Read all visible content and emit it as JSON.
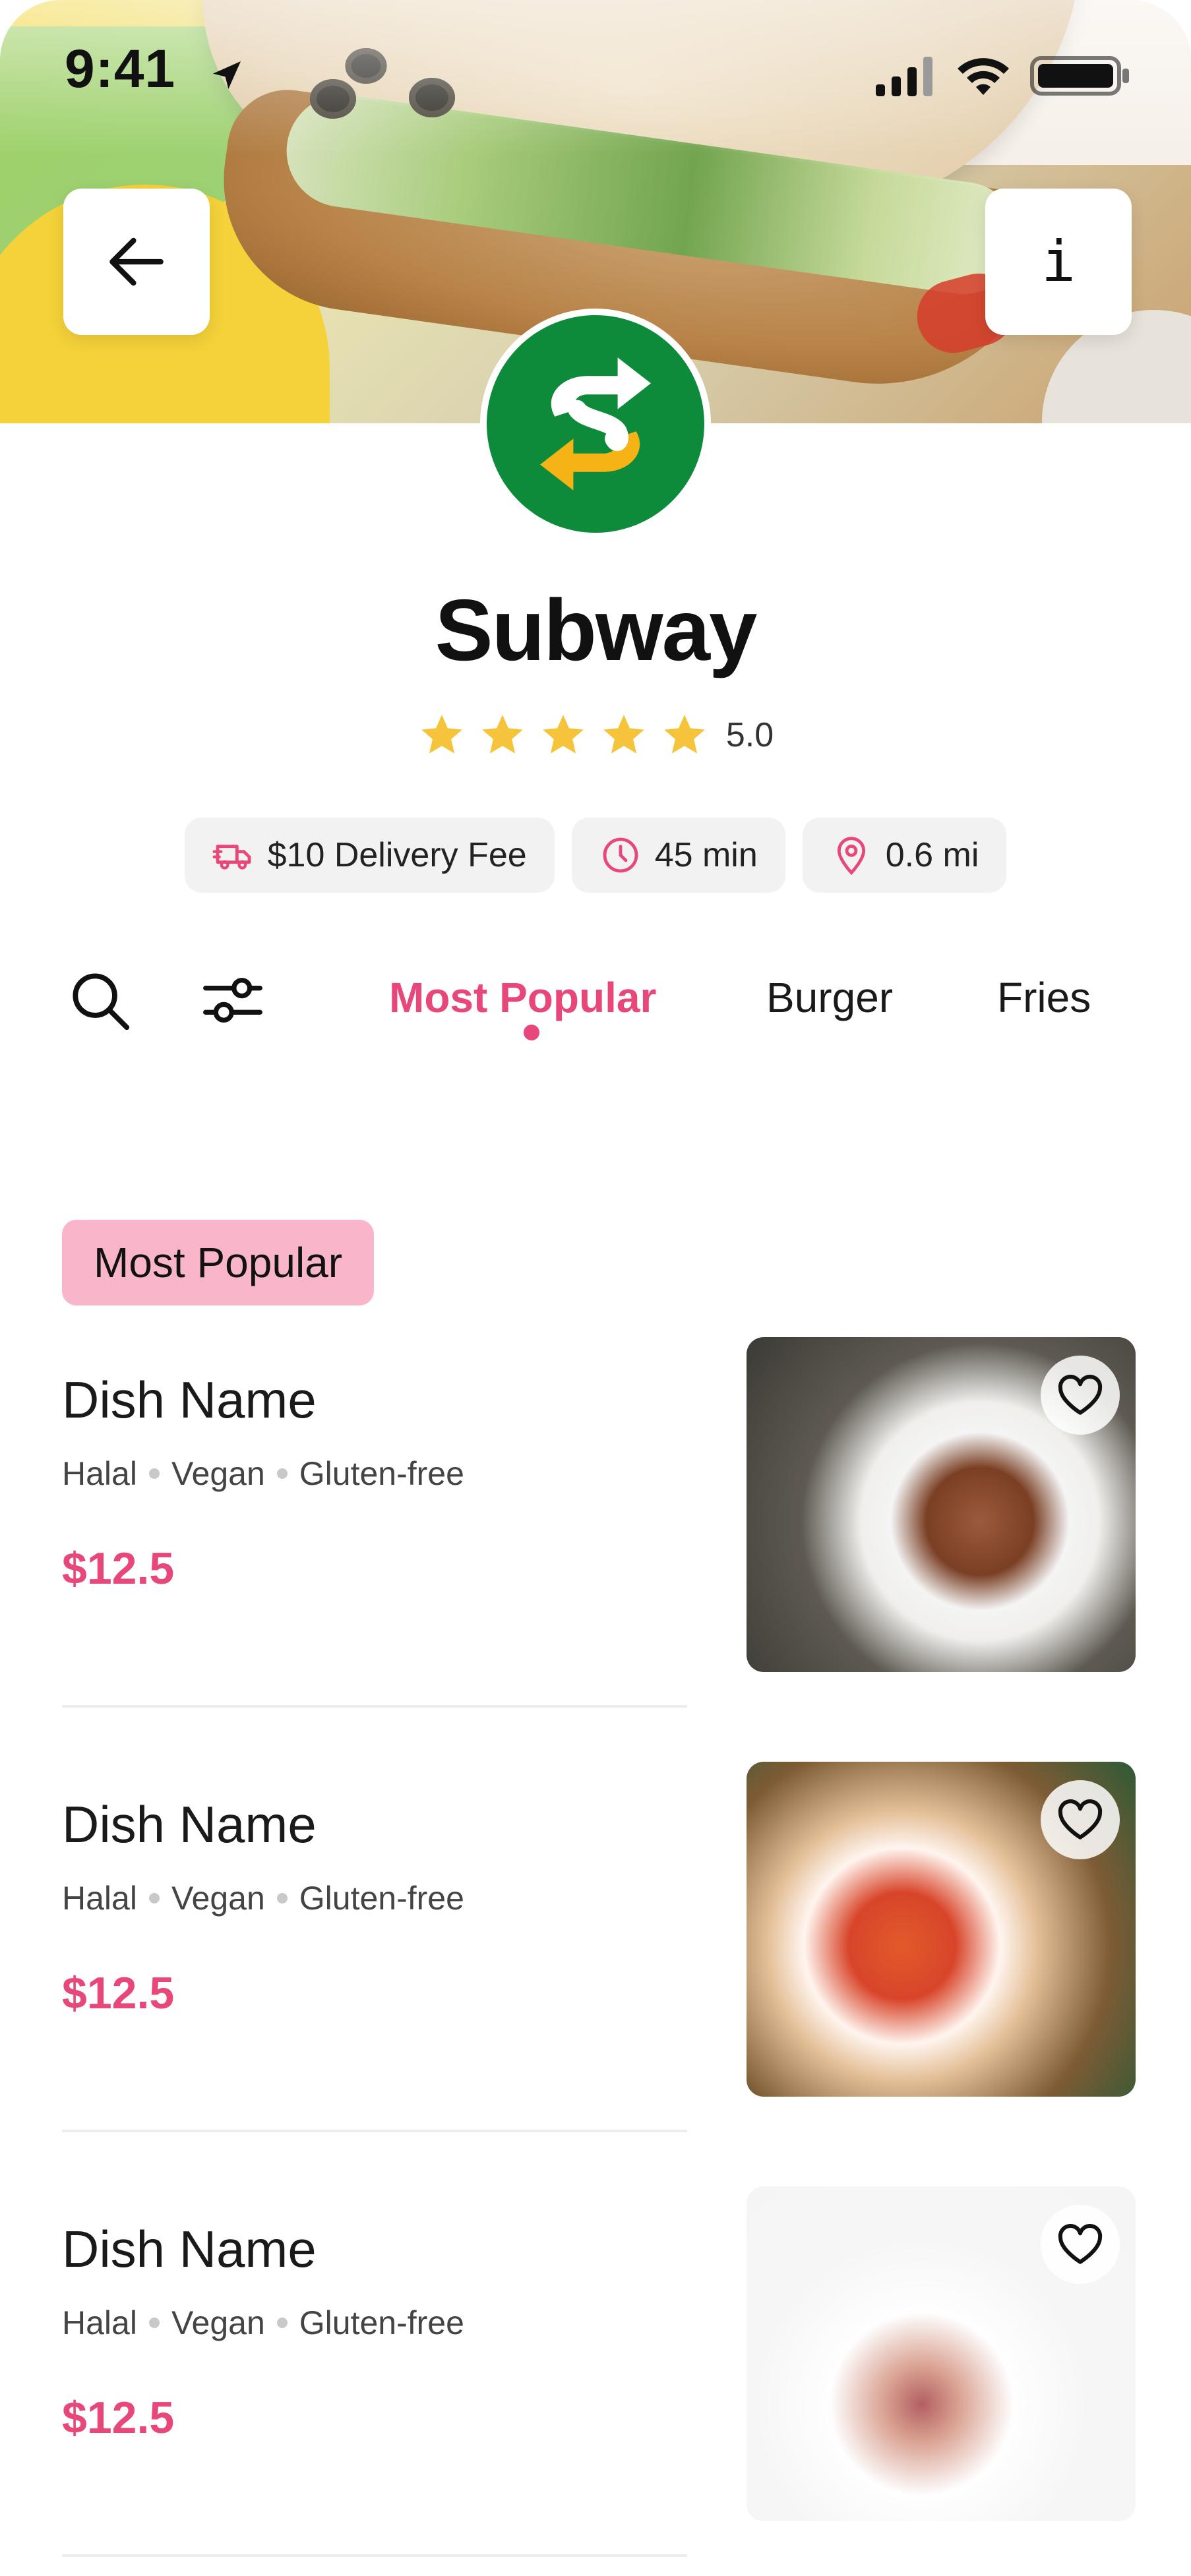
{
  "status_bar": {
    "time": "9:41"
  },
  "header": {
    "back_icon": "arrow-left-icon",
    "info_label": "i"
  },
  "restaurant": {
    "name": "Subway",
    "rating_value": "5.0",
    "rating_stars": 5,
    "chips": [
      {
        "icon": "delivery-truck-icon",
        "label": "$10 Delivery Fee"
      },
      {
        "icon": "clock-icon",
        "label": "45 min"
      },
      {
        "icon": "location-pin-icon",
        "label": "0.6 mi"
      }
    ]
  },
  "tabs": [
    {
      "label": "Most Popular",
      "active": true
    },
    {
      "label": "Burger",
      "active": false
    },
    {
      "label": "Fries",
      "active": false
    }
  ],
  "section": {
    "title": "Most Popular"
  },
  "dishes": [
    {
      "name": "Dish Name",
      "tags": [
        "Halal",
        "Vegan",
        "Gluten-free"
      ],
      "price": "$12.5"
    },
    {
      "name": "Dish Name",
      "tags": [
        "Halal",
        "Vegan",
        "Gluten-free"
      ],
      "price": "$12.5"
    },
    {
      "name": "Dish Name",
      "tags": [
        "Halal",
        "Vegan",
        "Gluten-free"
      ],
      "price": "$12.5"
    }
  ],
  "colors": {
    "accent": "#e8477a",
    "pill": "#f9b5ca",
    "star": "#f6c43a",
    "brand_green": "#0e8a3b",
    "brand_yellow": "#f5b315"
  }
}
